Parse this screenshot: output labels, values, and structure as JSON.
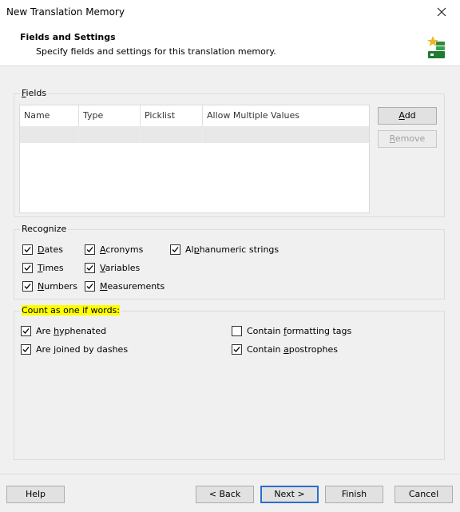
{
  "window": {
    "title": "New Translation Memory"
  },
  "header": {
    "title": "Fields and Settings",
    "subtitle": "Specify fields and settings for this translation memory."
  },
  "fields": {
    "group_label_prefix": "",
    "group_label_key": "F",
    "group_label_rest": "ields",
    "columns": [
      "Name",
      "Type",
      "Picklist",
      "Allow Multiple Values"
    ],
    "add_prefix": "",
    "add_key": "A",
    "add_rest": "dd",
    "remove_prefix": "",
    "remove_key": "R",
    "remove_rest": "emove"
  },
  "recognize": {
    "label": "Recognize",
    "items": [
      {
        "pre": "",
        "key": "D",
        "post": "ates",
        "checked": true
      },
      {
        "pre": "",
        "key": "T",
        "post": "imes",
        "checked": true
      },
      {
        "pre": "",
        "key": "N",
        "post": "umbers",
        "checked": true
      },
      {
        "pre": "",
        "key": "A",
        "post": "cronyms",
        "checked": true
      },
      {
        "pre": "",
        "key": "V",
        "post": "ariables",
        "checked": true
      },
      {
        "pre": "",
        "key": "M",
        "post": "easurements",
        "checked": true
      },
      {
        "pre": "Al",
        "key": "p",
        "post": "hanumeric strings",
        "checked": true
      }
    ]
  },
  "count": {
    "label": "Count as one if words:",
    "items": [
      {
        "pre": "Are ",
        "key": "h",
        "post": "yphenated",
        "checked": true
      },
      {
        "pre": "Are ",
        "key": "j",
        "post": "oined by dashes",
        "checked": true
      },
      {
        "pre": "Contain ",
        "key": "f",
        "post": "ormatting tags",
        "checked": false
      },
      {
        "pre": "Contain ",
        "key": "a",
        "post": "postrophes",
        "checked": true
      }
    ]
  },
  "footer": {
    "help": "Help",
    "back": "< Back",
    "next": "Next >",
    "finish": "Finish",
    "cancel": "Cancel"
  }
}
